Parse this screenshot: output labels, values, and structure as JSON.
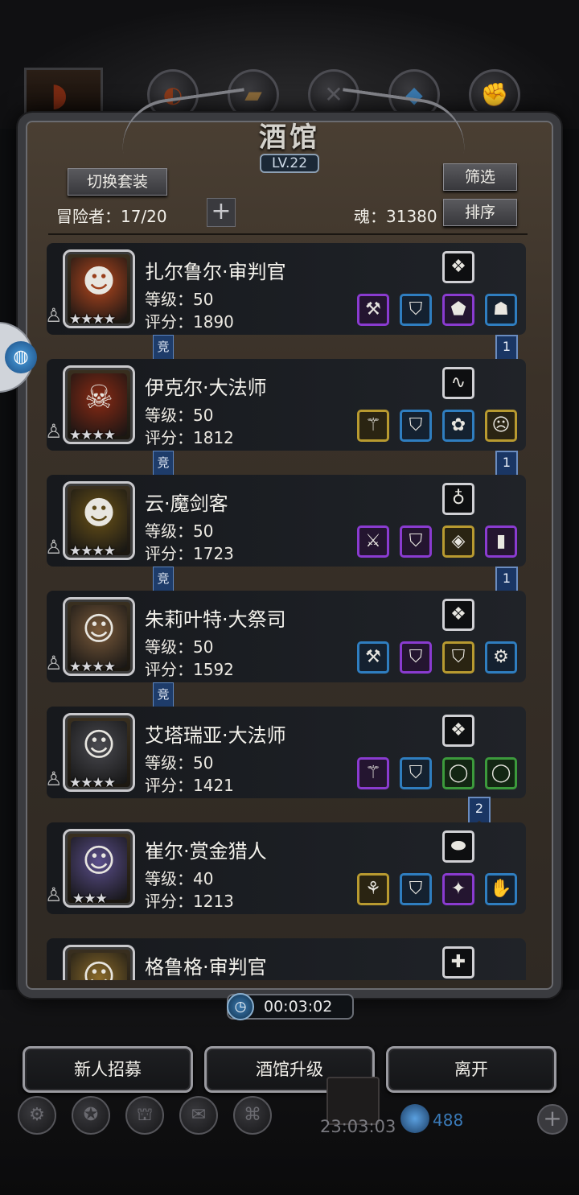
{
  "header": {
    "title": "酒馆",
    "level": "LV.22",
    "switch_outfit_label": "切换套装",
    "filter_label": "筛选",
    "sort_label": "排序",
    "adventurers_text": "冒险者：17/20",
    "souls_text": "魂：31380",
    "add_label": "+"
  },
  "heroes": [
    {
      "name": "扎尔鲁尔·审判官",
      "level": "等级：50",
      "score": "评分：1890",
      "stars": "★★★★",
      "arena": "竞",
      "ribbon": "1",
      "portrait_color": "#b5481e",
      "portrait_glyph": "☻",
      "frame_color": "#c8c8cc",
      "top_item": "crystal-icon",
      "top_glyph": "❖",
      "items": [
        {
          "name": "hammer-icon",
          "glyph": "⚒",
          "quality": "q-purple"
        },
        {
          "name": "armor-icon",
          "glyph": "⛉",
          "quality": "q-blue"
        },
        {
          "name": "shield-icon",
          "glyph": "⬟",
          "quality": "q-purple"
        },
        {
          "name": "helmet-icon",
          "glyph": "☗",
          "quality": "q-blue"
        }
      ]
    },
    {
      "name": "伊克尔·大法师",
      "level": "等级：50",
      "score": "评分：1812",
      "stars": "★★★★",
      "arena": "竞",
      "ribbon": "1",
      "portrait_color": "#8a2a14",
      "portrait_glyph": "☠",
      "frame_color": "#c8c8cc",
      "top_item": "whip-icon",
      "top_glyph": "∿",
      "items": [
        {
          "name": "staff-icon",
          "glyph": "⚚",
          "quality": "q-gold"
        },
        {
          "name": "robe-icon",
          "glyph": "⛉",
          "quality": "q-blue"
        },
        {
          "name": "necklace-icon",
          "glyph": "✿",
          "quality": "q-blue"
        },
        {
          "name": "mask-icon",
          "glyph": "☹",
          "quality": "q-gold"
        }
      ]
    },
    {
      "name": "云·魔剑客",
      "level": "等级：50",
      "score": "评分：1723",
      "stars": "★★★★",
      "arena": "竞",
      "ribbon": "1",
      "portrait_color": "#6a5218",
      "portrait_glyph": "☻",
      "frame_color": "#c8c8cc",
      "top_item": "amulet-icon",
      "top_glyph": "♁",
      "items": [
        {
          "name": "sword-icon",
          "glyph": "⚔",
          "quality": "q-purple"
        },
        {
          "name": "armor-icon",
          "glyph": "⛉",
          "quality": "q-purple"
        },
        {
          "name": "pendant-icon",
          "glyph": "◈",
          "quality": "q-gold"
        },
        {
          "name": "bracer-icon",
          "glyph": "▮",
          "quality": "q-purple"
        }
      ]
    },
    {
      "name": "朱莉叶特·大祭司",
      "level": "等级：50",
      "score": "评分：1592",
      "stars": "★★★★",
      "arena": "竞",
      "ribbon": "",
      "portrait_color": "#7a5a3a",
      "portrait_glyph": "☺",
      "frame_color": "#c8c8cc",
      "top_item": "crystal-icon",
      "top_glyph": "❖",
      "items": [
        {
          "name": "hammer-icon",
          "glyph": "⚒",
          "quality": "q-blue"
        },
        {
          "name": "armor-icon",
          "glyph": "⛉",
          "quality": "q-purple"
        },
        {
          "name": "robe-icon",
          "glyph": "⛉",
          "quality": "q-gold"
        },
        {
          "name": "chain-icon",
          "glyph": "⚙",
          "quality": "q-blue"
        }
      ]
    },
    {
      "name": "艾塔瑞亚·大法师",
      "level": "等级：50",
      "score": "评分：1421",
      "stars": "★★★★",
      "arena": "",
      "ribbon": "2",
      "portrait_color": "#4a4a50",
      "portrait_glyph": "☺",
      "frame_color": "#c8c8cc",
      "top_item": "crystal-icon",
      "top_glyph": "❖",
      "items": [
        {
          "name": "staff-icon",
          "glyph": "⚚",
          "quality": "q-purple"
        },
        {
          "name": "chestplate-icon",
          "glyph": "⛉",
          "quality": "q-blue"
        },
        {
          "name": "ring-icon",
          "glyph": "◯",
          "quality": "q-green"
        },
        {
          "name": "ring-icon",
          "glyph": "◯",
          "quality": "q-green"
        }
      ]
    },
    {
      "name": "崔尔·赏金猎人",
      "level": "等级：40",
      "score": "评分：1213",
      "stars": "★★★",
      "arena": "",
      "ribbon": "",
      "portrait_color": "#5a4e8a",
      "portrait_glyph": "☺",
      "frame_color": "#c8c8cc",
      "top_item": "stone-icon",
      "top_glyph": "⬬",
      "items": [
        {
          "name": "torch-icon",
          "glyph": "⚘",
          "quality": "q-gold"
        },
        {
          "name": "robe-icon",
          "glyph": "⛉",
          "quality": "q-blue"
        },
        {
          "name": "amulet-icon",
          "glyph": "✦",
          "quality": "q-purple"
        },
        {
          "name": "gauntlet-icon",
          "glyph": "✋",
          "quality": "q-blue"
        }
      ]
    },
    {
      "name": "格鲁格·审判官",
      "level": "",
      "score": "",
      "stars": "",
      "arena": "",
      "ribbon": "",
      "portrait_color": "#8a6a2a",
      "portrait_glyph": "☺",
      "frame_color": "#c8c8cc",
      "top_item": "add-gem-icon",
      "top_glyph": "✚",
      "items": []
    }
  ],
  "timer": "00:03:02",
  "footer": {
    "recruit_label": "新人招募",
    "upgrade_label": "酒馆升级",
    "leave_label": "离开",
    "bottom_time": "23:03:03",
    "gem_count": "488"
  }
}
